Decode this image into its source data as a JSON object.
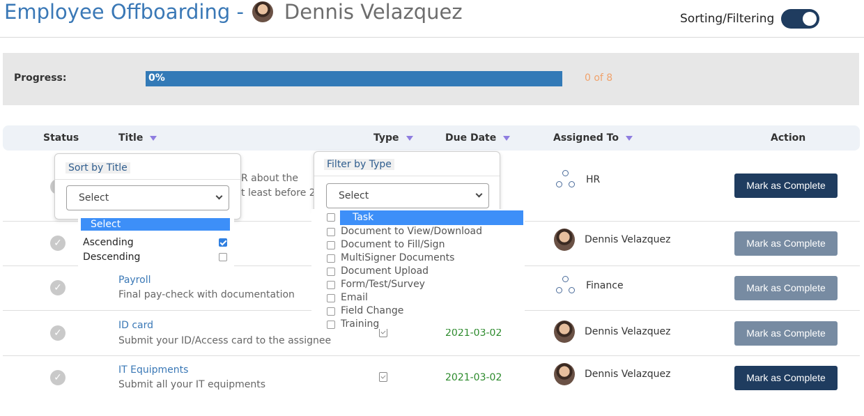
{
  "header": {
    "title_prefix": "Employee Offboarding -",
    "person_name": "Dennis Velazquez",
    "toggle_label": "Sorting/Filtering",
    "toggle_on": true
  },
  "progress": {
    "label": "Progress:",
    "percent_text": "0%",
    "percent_value": 0,
    "count_text": "0 of 8"
  },
  "columns": {
    "status": "Status",
    "title": "Title",
    "type": "Type",
    "due_date": "Due Date",
    "assigned_to": "Assigned To",
    "action": "Action"
  },
  "sort_panel": {
    "title": "Sort by Title",
    "select_value": "Select",
    "options": [
      {
        "label": "Select",
        "highlighted": true
      },
      {
        "label": "Ascending",
        "checked": true
      },
      {
        "label": "Descending",
        "checked": false
      }
    ]
  },
  "filter_panel": {
    "title": "Filter by Type",
    "select_value": "Select",
    "options": [
      {
        "label": "Task",
        "highlighted": true
      },
      {
        "label": "Document to View/Download"
      },
      {
        "label": "Document to Fill/Sign"
      },
      {
        "label": "MultiSigner Documents"
      },
      {
        "label": "Document Upload"
      },
      {
        "label": "Form/Test/Survey"
      },
      {
        "label": "Email"
      },
      {
        "label": "Field Change"
      },
      {
        "label": "Training"
      }
    ]
  },
  "rows": [
    {
      "desc_partial_1": "R about the",
      "desc_partial_2": "t least before 2",
      "assignee": "HR",
      "assignee_kind": "group",
      "action": "Mark as Complete",
      "action_enabled": true
    },
    {
      "assignee": "Dennis Velazquez",
      "assignee_kind": "person",
      "action": "Mark as Complete",
      "action_enabled": false
    },
    {
      "title": "Payroll",
      "description": "Final pay-check with documentation",
      "assignee": "Finance",
      "assignee_kind": "group",
      "action": "Mark as Complete",
      "action_enabled": false
    },
    {
      "title": "ID card",
      "description": "Submit your ID/Access card to the assignee",
      "due_date": "2021-03-02",
      "assignee": "Dennis Velazquez",
      "assignee_kind": "person",
      "action": "Mark as Complete",
      "action_enabled": false
    },
    {
      "title": "IT Equipments",
      "description": "Submit all your IT equipments",
      "due_date": "2021-03-02",
      "assignee": "Dennis Velazquez",
      "assignee_kind": "person",
      "action": "Mark as Complete",
      "action_enabled": true
    }
  ],
  "colors": {
    "brand_blue": "#3a78b6",
    "button_dark": "#1f3c5f",
    "button_muted": "#778ba2",
    "progress_fill": "#337ab7",
    "due_green": "#2c8a2c",
    "count_orange": "#f0a26b"
  }
}
